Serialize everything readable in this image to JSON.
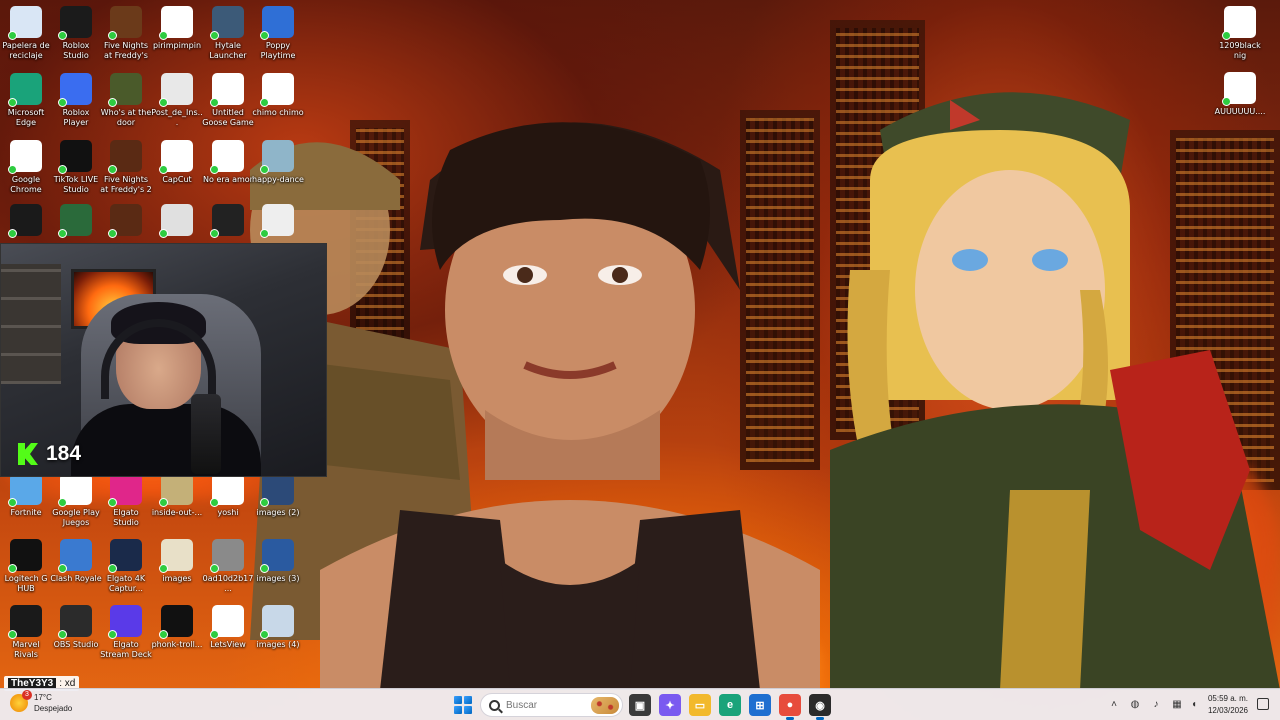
{
  "desktop": {
    "icons_top": [
      {
        "label": "Papelera de reciclaje",
        "icon": "recycle-bin-icon",
        "color": "#d9e6f5"
      },
      {
        "label": "Roblox Studio",
        "icon": "roblox-studio-icon",
        "color": "#1b1b1b"
      },
      {
        "label": "Five Nights at Freddy's",
        "icon": "fnaf-icon",
        "color": "#6b3a1a"
      },
      {
        "label": "pirimpimpin",
        "icon": "file-icon",
        "color": "#ffffff"
      },
      {
        "label": "Hytale Launcher",
        "icon": "hytale-icon",
        "color": "#3c5a78"
      },
      {
        "label": "Poppy Playtime",
        "icon": "poppy-playtime-icon",
        "color": "#2f6fd6"
      },
      {
        "label": "Microsoft Edge",
        "icon": "edge-icon",
        "color": "#1aa37a"
      },
      {
        "label": "Roblox Player",
        "icon": "roblox-icon",
        "color": "#3a6df0"
      },
      {
        "label": "Who's at the door",
        "icon": "game-icon",
        "color": "#4a5a2a"
      },
      {
        "label": "Post_de_Ins...",
        "icon": "file-icon",
        "color": "#e8e8e8"
      },
      {
        "label": "Untitled Goose Game",
        "icon": "goose-game-icon",
        "color": "#ffffff"
      },
      {
        "label": "chimo chimo",
        "icon": "video-file-icon",
        "color": "#ffffff"
      },
      {
        "label": "Google Chrome",
        "icon": "chrome-icon",
        "color": "#ffffff"
      },
      {
        "label": "TikTok LIVE Studio",
        "icon": "tiktok-icon",
        "color": "#111111"
      },
      {
        "label": "Five Nights at Freddy's 2",
        "icon": "fnaf2-icon",
        "color": "#5a2a14"
      },
      {
        "label": "CapCut",
        "icon": "capcut-icon",
        "color": "#ffffff"
      },
      {
        "label": "No era amor",
        "icon": "video-file-icon",
        "color": "#ffffff"
      },
      {
        "label": "happy-dance",
        "icon": "image-file-icon",
        "color": "#8fb5c9"
      }
    ],
    "icons_partial": [
      {
        "label": "",
        "icon": "nvidia-icon",
        "color": "#1a1a1a"
      },
      {
        "label": "",
        "icon": "game-icon",
        "color": "#2a6a3a"
      },
      {
        "label": "",
        "icon": "fnaf-icon",
        "color": "#5a2a14"
      },
      {
        "label": "",
        "icon": "app-icon",
        "color": "#e0e0e0"
      },
      {
        "label": "",
        "icon": "image-file-icon",
        "color": "#222222"
      },
      {
        "label": "",
        "icon": "image-file-icon",
        "color": "#eeeeee"
      }
    ],
    "icons_bottom": [
      {
        "label": "Fortnite",
        "icon": "fortnite-icon",
        "color": "#5aa8e8"
      },
      {
        "label": "Google Play Juegos",
        "icon": "google-play-icon",
        "color": "#ffffff"
      },
      {
        "label": "Elgato Studio",
        "icon": "elgato-studio-icon",
        "color": "#e0268a"
      },
      {
        "label": "inside-out-...",
        "icon": "image-file-icon",
        "color": "#c4b078"
      },
      {
        "label": "yoshi",
        "icon": "video-file-icon",
        "color": "#ffffff"
      },
      {
        "label": "images (2)",
        "icon": "image-file-icon",
        "color": "#2c4a78"
      },
      {
        "label": "Logitech G HUB",
        "icon": "logitech-icon",
        "color": "#111111"
      },
      {
        "label": "Clash Royale",
        "icon": "clash-royale-icon",
        "color": "#3a7ad0"
      },
      {
        "label": "Elgato 4K Captur...",
        "icon": "elgato-4k-icon",
        "color": "#1a2a4a"
      },
      {
        "label": "images",
        "icon": "image-file-icon",
        "color": "#e8e0c8"
      },
      {
        "label": "0ad10d2b17...",
        "icon": "image-file-icon",
        "color": "#8a8a8a"
      },
      {
        "label": "images (3)",
        "icon": "image-file-icon",
        "color": "#2a5aa0"
      },
      {
        "label": "Marvel Rivals",
        "icon": "marvel-rivals-icon",
        "color": "#1a1a1a"
      },
      {
        "label": "OBS Studio",
        "icon": "obs-icon",
        "color": "#2b2b2b"
      },
      {
        "label": "Elgato Stream Deck",
        "icon": "stream-deck-icon",
        "color": "#5a3ae8"
      },
      {
        "label": "phonk-troll...",
        "icon": "image-file-icon",
        "color": "#111111"
      },
      {
        "label": "LetsView",
        "icon": "letsview-icon",
        "color": "#ffffff"
      },
      {
        "label": "images (4)",
        "icon": "image-file-icon",
        "color": "#c8d8e8"
      }
    ],
    "icons_right": [
      {
        "label": "1209black nig",
        "icon": "video-file-icon",
        "color": "#ffffff"
      },
      {
        "label": "AUUUUUU....",
        "icon": "video-file-icon",
        "color": "#ffffff"
      }
    ]
  },
  "webcam": {
    "viewer_count": "184",
    "platform_icon": "kick-logo-icon",
    "accent": "#53fc18"
  },
  "chat": {
    "user": "TheY3Y3",
    "message": ": xd"
  },
  "taskbar": {
    "weather_temp": "17°C",
    "weather_desc": "Despejado",
    "weather_alert": "3",
    "search_placeholder": "Buscar",
    "apps": [
      {
        "name": "task-view",
        "icon": "task-view-icon",
        "color": "#3a3a3a",
        "glyph": "▣"
      },
      {
        "name": "copilot",
        "icon": "copilot-icon",
        "color": "#7a5af0",
        "glyph": "✦"
      },
      {
        "name": "file-explorer",
        "icon": "folder-icon",
        "color": "#f2b92c",
        "glyph": "▭"
      },
      {
        "name": "edge",
        "icon": "edge-icon",
        "color": "#1aa37a",
        "glyph": "e"
      },
      {
        "name": "store",
        "icon": "store-icon",
        "color": "#1f6fd0",
        "glyph": "⊞"
      },
      {
        "name": "chrome",
        "icon": "chrome-icon",
        "color": "#e74c3c",
        "glyph": "●"
      },
      {
        "name": "obs",
        "icon": "obs-icon",
        "color": "#2b2b2b",
        "glyph": "◉"
      }
    ],
    "time": "05:59 a. m.",
    "date": "12/03/2026"
  }
}
